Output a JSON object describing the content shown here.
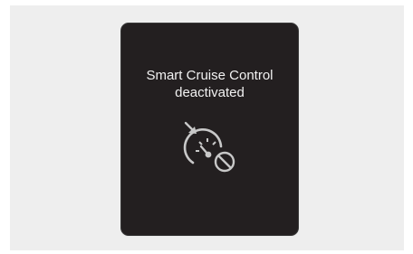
{
  "notification": {
    "line1": "Smart Cruise Control",
    "line2": "deactivated",
    "icon": "cruise-control-off-icon",
    "background_color": "#231f20",
    "text_color": "#f2f2f2",
    "icon_color": "#c8c8c8"
  }
}
